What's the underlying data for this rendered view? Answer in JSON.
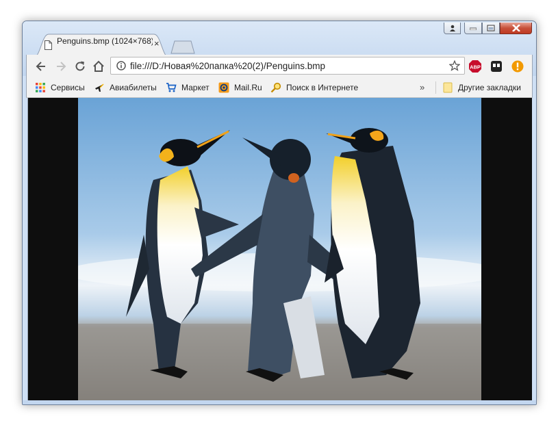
{
  "window": {
    "controls": [
      "user",
      "minimize",
      "maximize",
      "close"
    ]
  },
  "tab": {
    "title": "Penguins.bmp (1024×768)",
    "close_glyph": "×",
    "icon": "document-icon"
  },
  "nav": {
    "back": "arrow-left-icon",
    "forward": "arrow-right-icon",
    "reload": "reload-icon",
    "home": "home-icon"
  },
  "omnibox": {
    "url": "file:///D:/Новая%20папка%20(2)/Penguins.bmp",
    "info_icon": "info-icon",
    "star_icon": "star-icon"
  },
  "extensions": [
    {
      "name": "adblock-plus",
      "label": "ABP",
      "color": "#c70d2c"
    },
    {
      "name": "tabs-extension",
      "color": "#222222"
    },
    {
      "name": "alert-extension",
      "label": "!",
      "color": "#f29900"
    }
  ],
  "bookmarks": {
    "items": [
      {
        "label": "Сервисы",
        "icon": "apps-grid-icon"
      },
      {
        "label": "Авиабилеты",
        "icon": "plane-icon"
      },
      {
        "label": "Маркет",
        "icon": "cart-icon"
      },
      {
        "label": "Mail.Ru",
        "icon": "mailru-icon"
      },
      {
        "label": "Поиск в Интернете",
        "icon": "search-icon"
      }
    ],
    "more": "»",
    "other": {
      "label": "Другие закладки",
      "icon": "folder-icon"
    }
  },
  "content": {
    "image": "penguins-photo",
    "background": "#0e0e0e"
  }
}
